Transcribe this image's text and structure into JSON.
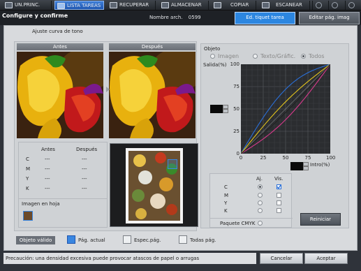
{
  "nav": {
    "tabs": [
      {
        "label": "UN.PRINC.",
        "icon": "home-icon"
      },
      {
        "label": "LISTA TAREAS",
        "icon": "job-list-icon"
      },
      {
        "label": "RECUPERAR",
        "icon": "recall-icon"
      },
      {
        "label": "ALMACENAR",
        "icon": "store-icon"
      },
      {
        "label": "COPIAR",
        "icon": "copy-icon"
      },
      {
        "label": "ESCANEAR",
        "icon": "scan-icon"
      }
    ],
    "active_index": 1
  },
  "header": {
    "title": "Configure y confirme",
    "filename_label": "Nombre arch.",
    "filename_value": "0599",
    "tab_ticket": "Ed. tiquet tarea",
    "tab_edit": "Editar pág. imag"
  },
  "panel": {
    "title": "Ajuste curva de tono",
    "before_label": "Antes",
    "after_label": "Después"
  },
  "table": {
    "col_before": "Antes",
    "col_after": "Después",
    "rows": [
      {
        "ch": "C",
        "before": "---",
        "after": "---"
      },
      {
        "ch": "M",
        "before": "---",
        "after": "---"
      },
      {
        "ch": "Y",
        "before": "---",
        "after": "---"
      },
      {
        "ch": "K",
        "before": "---",
        "after": "---"
      }
    ]
  },
  "sheet": {
    "label": "Imagen en hoja"
  },
  "objeto": {
    "title": "Objeto",
    "options": [
      "Imagen",
      "Texto/Gráfic.",
      "Todos"
    ],
    "selected": "Todos"
  },
  "curve": {
    "ylabel": "Salida(%)",
    "xlabel": "Intro(%)",
    "yticks": [
      "100",
      "75",
      "50",
      "25",
      "0"
    ],
    "xticks": [
      "0",
      "25",
      "50",
      "75",
      "100"
    ],
    "range": [
      0,
      100
    ],
    "series_colors": [
      "#2a6fd8",
      "#d93a8c",
      "#e3c41d",
      "#222222"
    ]
  },
  "channels": {
    "col_adj": "Aj.",
    "col_vis": "Vis.",
    "rows": [
      {
        "ch": "C",
        "adj": true,
        "vis": true
      },
      {
        "ch": "M",
        "adj": false,
        "vis": false
      },
      {
        "ch": "Y",
        "adj": false,
        "vis": false
      },
      {
        "ch": "K",
        "adj": false,
        "vis": false
      }
    ],
    "package_label": "Paquete CMYK"
  },
  "buttons": {
    "reset": "Reiniciar",
    "cancel": "Cancelar",
    "accept": "Aceptar"
  },
  "valid_object": {
    "label": "Objeto válido",
    "options": [
      "Pág. actual",
      "Espec.pág.",
      "Todas pág."
    ],
    "selected": "Pág. actual"
  },
  "footer": {
    "message": "Precaución: una densidad excesiva puede provocar atascos de papel o arrugas"
  }
}
